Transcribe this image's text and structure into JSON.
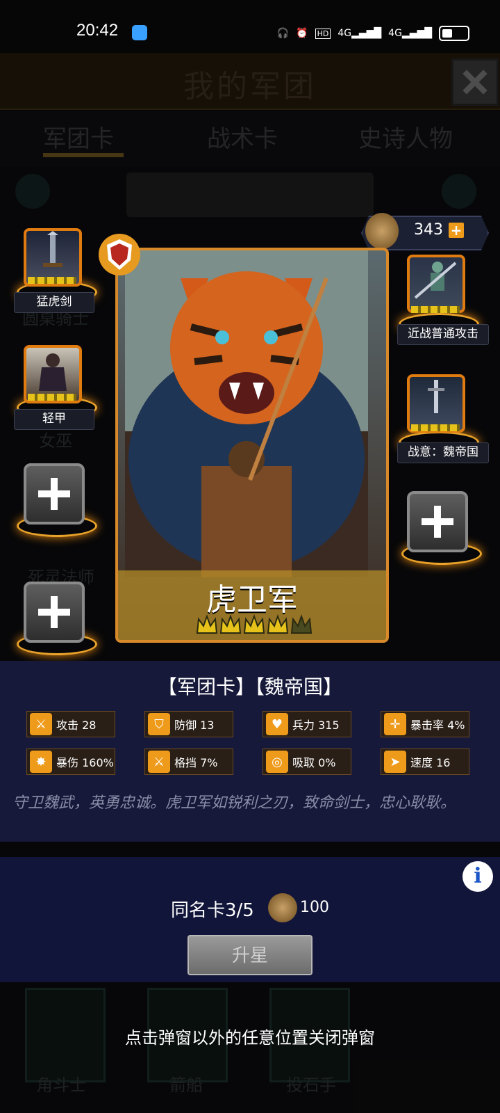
{
  "status_bar": {
    "time": "20:42",
    "icons": [
      "headphone-icon",
      "alarm-icon",
      "hd-icon",
      "signal-4g-icon",
      "signal-4g-icon",
      "battery-icon"
    ]
  },
  "background": {
    "title": "我的军团",
    "tabs": [
      "军团卡",
      "战术卡",
      "史诗人物"
    ],
    "grid_labels": [
      "圆桌骑士",
      "女巫",
      "死灵法师",
      "角斗士",
      "箭船",
      "投石手"
    ]
  },
  "currency": {
    "value": "343"
  },
  "left_slots": [
    {
      "label": "猛虎剑",
      "stars": 5
    },
    {
      "label": "轻甲",
      "stars": 5
    }
  ],
  "right_slots": [
    {
      "label": "近战普通攻击",
      "stars": 5
    },
    {
      "label": "战意：魏帝国",
      "stars": 5
    }
  ],
  "card": {
    "name": "虎卫军",
    "stars_filled": 4,
    "stars_total": 5
  },
  "info": {
    "title": "【军团卡】【魏帝国】",
    "stats": [
      {
        "icon": "sword-icon",
        "text": "攻击 28"
      },
      {
        "icon": "shield-icon",
        "text": "防御 13"
      },
      {
        "icon": "heart-icon",
        "text": "兵力 315"
      },
      {
        "icon": "crosshair-icon",
        "text": "暴击率 4%"
      },
      {
        "icon": "burst-icon",
        "text": "暴伤 160%"
      },
      {
        "icon": "parry-icon",
        "text": "格挡 7%"
      },
      {
        "icon": "drain-icon",
        "text": "吸取 0%"
      },
      {
        "icon": "boot-icon",
        "text": "速度 16"
      }
    ],
    "lore": "守卫魏武，英勇忠诚。虎卫军如锐利之刃，致命剑士，忠心耿耿。"
  },
  "upgrade": {
    "duplicate_text": "同名卡3/5",
    "cost": "100",
    "button_label": "升星"
  },
  "hint": "点击弹窗以外的任意位置关闭弹窗",
  "colors": {
    "accent": "#ee9a1a",
    "panel": "#16193a",
    "frame": "#d88a2a",
    "crown": "#e6c21a"
  }
}
